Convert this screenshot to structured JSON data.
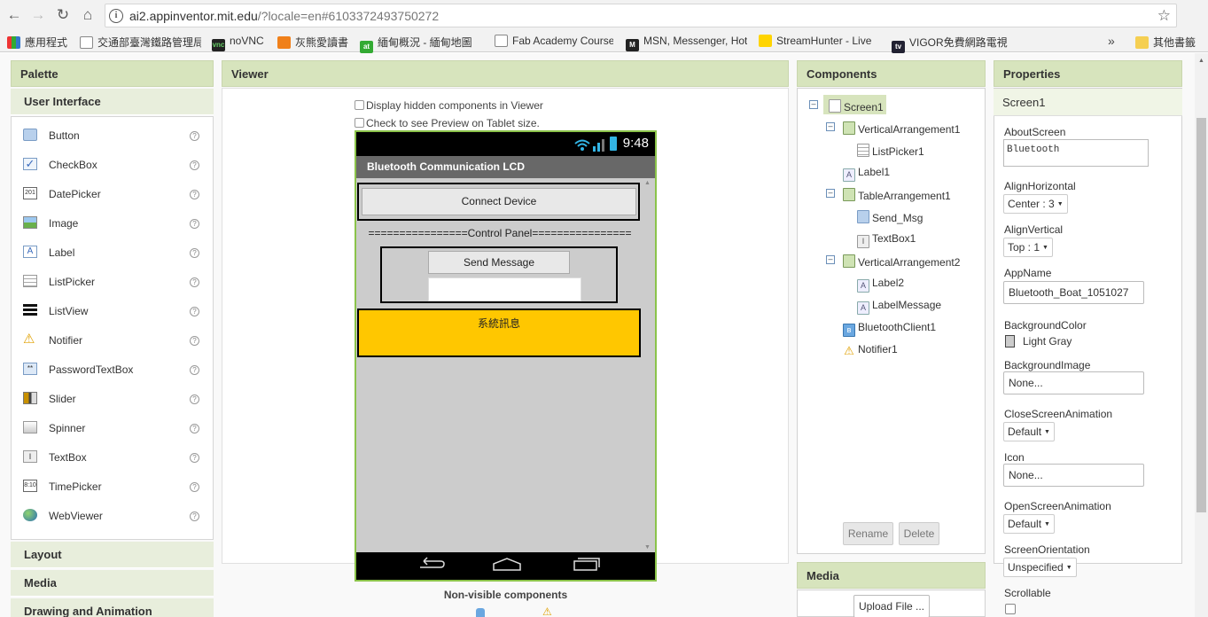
{
  "browser": {
    "url_host": "ai2.appinventor.mit.edu",
    "url_rest": "/?locale=en#6103372493750272",
    "bookmarks": [
      "應用程式",
      "交通部臺灣鐵路管理局",
      "noVNC",
      "灰熊愛讀書",
      "緬甸概況 - 緬甸地圖",
      "Fab Academy Course",
      "MSN, Messenger, Hotmail",
      "StreamHunter - Live",
      "VIGOR免費網路電視",
      "其他書籤"
    ],
    "more": "»"
  },
  "palette": {
    "title": "Palette",
    "category_open": "User Interface",
    "items": [
      {
        "label": "Button",
        "icon": "button-icon"
      },
      {
        "label": "CheckBox",
        "icon": "checkbox-icon"
      },
      {
        "label": "DatePicker",
        "icon": "datepicker-icon"
      },
      {
        "label": "Image",
        "icon": "image-icon"
      },
      {
        "label": "Label",
        "icon": "label-icon"
      },
      {
        "label": "ListPicker",
        "icon": "listpicker-icon"
      },
      {
        "label": "ListView",
        "icon": "listview-icon"
      },
      {
        "label": "Notifier",
        "icon": "notifier-icon"
      },
      {
        "label": "PasswordTextBox",
        "icon": "passwordtextbox-icon"
      },
      {
        "label": "Slider",
        "icon": "slider-icon"
      },
      {
        "label": "Spinner",
        "icon": "spinner-icon"
      },
      {
        "label": "TextBox",
        "icon": "textbox-icon"
      },
      {
        "label": "TimePicker",
        "icon": "timepicker-icon"
      },
      {
        "label": "WebViewer",
        "icon": "webviewer-icon"
      }
    ],
    "help": "?",
    "categories_closed": [
      "Layout",
      "Media",
      "Drawing and Animation"
    ]
  },
  "viewer": {
    "title": "Viewer",
    "option_hidden": "Display hidden components in Viewer",
    "option_tablet": "Check to see Preview on Tablet size.",
    "phone": {
      "time": "9:48",
      "app_title": "Bluetooth Communication LCD",
      "connect_button": "Connect Device",
      "control_panel": "================Control Panel================",
      "send_button": "Send Message",
      "label_message": "系統訊息"
    },
    "nonvisible_label": "Non-visible components"
  },
  "components": {
    "title": "Components",
    "tree": [
      {
        "label": "Screen1",
        "icon": "screen-icon"
      },
      {
        "label": "VerticalArrangement1",
        "icon": "arrangement-icon"
      },
      {
        "label": "ListPicker1",
        "icon": "listpicker-icon"
      },
      {
        "label": "Label1",
        "icon": "label-icon"
      },
      {
        "label": "TableArrangement1",
        "icon": "arrangement-icon"
      },
      {
        "label": "Send_Msg",
        "icon": "button-icon"
      },
      {
        "label": "TextBox1",
        "icon": "textbox-icon"
      },
      {
        "label": "VerticalArrangement2",
        "icon": "arrangement-icon"
      },
      {
        "label": "Label2",
        "icon": "label-icon"
      },
      {
        "label": "LabelMessage",
        "icon": "label-icon"
      },
      {
        "label": "BluetoothClient1",
        "icon": "bluetooth-icon"
      },
      {
        "label": "Notifier1",
        "icon": "notifier-icon"
      }
    ],
    "rename": "Rename",
    "delete": "Delete"
  },
  "media": {
    "title": "Media",
    "upload": "Upload File ..."
  },
  "properties": {
    "title": "Properties",
    "selected": "Screen1",
    "about_label": "AboutScreen",
    "about_value": "Bluetooth",
    "align_h_label": "AlignHorizontal",
    "align_h_value": "Center : 3",
    "align_v_label": "AlignVertical",
    "align_v_value": "Top : 1",
    "appname_label": "AppName",
    "appname_value": "Bluetooth_Boat_1051027",
    "bgcolor_label": "BackgroundColor",
    "bgcolor_value": "Light Gray",
    "bgimage_label": "BackgroundImage",
    "bgimage_value": "None...",
    "close_anim_label": "CloseScreenAnimation",
    "close_anim_value": "Default",
    "icon_label": "Icon",
    "icon_value": "None...",
    "open_anim_label": "OpenScreenAnimation",
    "open_anim_value": "Default",
    "orientation_label": "ScreenOrientation",
    "orientation_value": "Unspecified",
    "scrollable_label": "Scrollable"
  },
  "colors": {
    "panel_header": "#d7e4bd",
    "phone_border": "#8bc34a",
    "label_message_bg": "#ffc700"
  }
}
